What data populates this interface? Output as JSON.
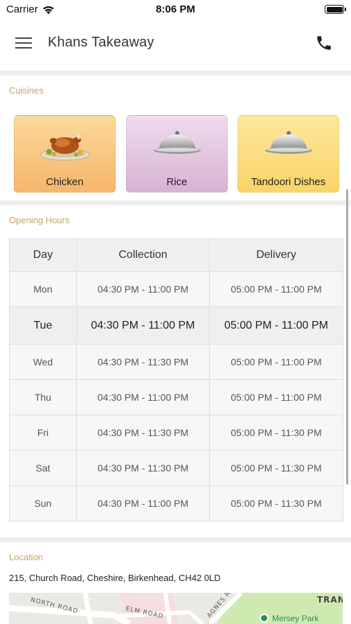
{
  "status_bar": {
    "carrier": "Carrier",
    "time": "8:06 PM"
  },
  "header": {
    "title": "Khans Takeaway",
    "menu_icon": "hamburger-menu-icon",
    "call_icon": "phone-icon"
  },
  "cuisines": {
    "section_label": "Cuisines",
    "items": [
      {
        "label": "Chicken",
        "icon": "roast-chicken-icon",
        "color": "#f6b56b"
      },
      {
        "label": "Rice",
        "icon": "serving-cloche-icon",
        "color": "#d8b2d4"
      },
      {
        "label": "Tandoori Dishes",
        "icon": "serving-cloche-icon",
        "color": "#f9d46a"
      }
    ]
  },
  "opening_hours": {
    "section_label": "Opening Hours",
    "columns": [
      "Day",
      "Collection",
      "Delivery"
    ],
    "rows": [
      {
        "day": "Mon",
        "collection": "04:30 PM - 11:00 PM",
        "delivery": "05:00 PM - 11:00 PM"
      },
      {
        "day": "Tue",
        "collection": "04:30 PM - 11:00 PM",
        "delivery": "05:00 PM - 11:00 PM"
      },
      {
        "day": "Wed",
        "collection": "04:30 PM - 11:30 PM",
        "delivery": "05:00 PM - 11:00 PM"
      },
      {
        "day": "Thu",
        "collection": "04:30 PM - 11:00 PM",
        "delivery": "05:00 PM - 11:00 PM"
      },
      {
        "day": "Fri",
        "collection": "04:30 PM - 11:30 PM",
        "delivery": "05:00 PM - 11:30 PM"
      },
      {
        "day": "Sat",
        "collection": "04:30 PM - 11:30 PM",
        "delivery": "05:00 PM - 11:30 PM"
      },
      {
        "day": "Sun",
        "collection": "04:30 PM - 11:00 PM",
        "delivery": "05:00 PM - 11:30 PM"
      }
    ]
  },
  "location": {
    "section_label": "Location",
    "address": "215, Church Road, Cheshire, Birkenhead, CH42 0LD",
    "map_labels": {
      "north_road": "NORTH ROAD",
      "elm_road": "ELM ROAD",
      "agnes_road": "AGNES R",
      "tran": "TRAN",
      "park": "Mersey Park"
    }
  },
  "colors": {
    "accent": "#c3a36a",
    "divider": "#eeeeee",
    "table_border": "#dddddd"
  }
}
